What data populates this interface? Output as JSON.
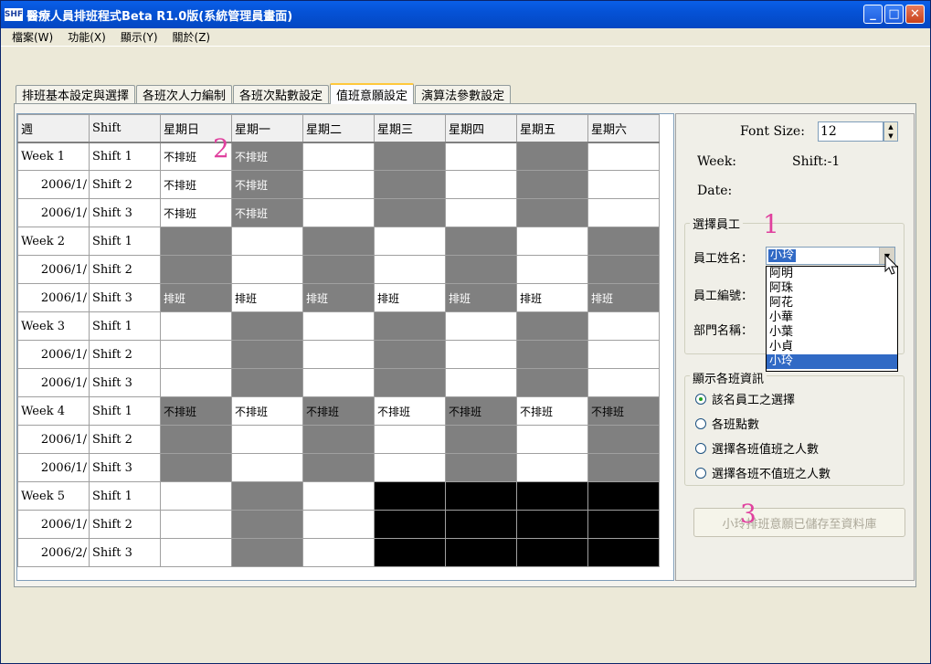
{
  "window": {
    "icon_text": "SHF",
    "title": "醫療人員排班程式Beta R1.0版(系統管理員畫面)",
    "controls": {
      "minimize": "_",
      "maximize": "□",
      "close": "✕"
    }
  },
  "menu": [
    "檔案(W)",
    "功能(X)",
    "顯示(Y)",
    "關於(Z)"
  ],
  "tabs": [
    {
      "label": "排班基本設定與選擇",
      "active": false
    },
    {
      "label": "各班次人力編制",
      "active": false
    },
    {
      "label": "各班次點數設定",
      "active": false
    },
    {
      "label": "值班意願設定",
      "active": true
    },
    {
      "label": "演算法參數設定",
      "active": false
    }
  ],
  "grid": {
    "headers": [
      "週",
      "Shift",
      "星期日",
      "星期一",
      "星期二",
      "星期三",
      "星期四",
      "星期五",
      "星期六"
    ],
    "rows": [
      {
        "week": "Week 1",
        "shift": "Shift 1",
        "sub": false,
        "cells": [
          [
            "不排班",
            "w"
          ],
          [
            "不排班",
            "g"
          ],
          [
            "",
            "w"
          ],
          [
            "",
            "g"
          ],
          [
            "",
            "w"
          ],
          [
            "",
            "g"
          ],
          [
            "",
            "w"
          ]
        ]
      },
      {
        "week": "2006/1/",
        "shift": "Shift 2",
        "sub": true,
        "cells": [
          [
            "不排班",
            "w"
          ],
          [
            "不排班",
            "g"
          ],
          [
            "",
            "w"
          ],
          [
            "",
            "g"
          ],
          [
            "",
            "w"
          ],
          [
            "",
            "g"
          ],
          [
            "",
            "w"
          ]
        ]
      },
      {
        "week": "2006/1/",
        "shift": "Shift 3",
        "sub": true,
        "cells": [
          [
            "不排班",
            "w"
          ],
          [
            "不排班",
            "g"
          ],
          [
            "",
            "w"
          ],
          [
            "",
            "g"
          ],
          [
            "",
            "w"
          ],
          [
            "",
            "g"
          ],
          [
            "",
            "w"
          ]
        ]
      },
      {
        "week": "Week 2",
        "shift": "Shift 1",
        "sub": false,
        "cells": [
          [
            "",
            "g"
          ],
          [
            "",
            "w"
          ],
          [
            "",
            "g"
          ],
          [
            "",
            "w"
          ],
          [
            "",
            "g"
          ],
          [
            "",
            "w"
          ],
          [
            "",
            "g"
          ]
        ]
      },
      {
        "week": "2006/1/",
        "shift": "Shift 2",
        "sub": true,
        "cells": [
          [
            "",
            "g"
          ],
          [
            "",
            "w"
          ],
          [
            "",
            "g"
          ],
          [
            "",
            "w"
          ],
          [
            "",
            "g"
          ],
          [
            "",
            "w"
          ],
          [
            "",
            "g"
          ]
        ]
      },
      {
        "week": "2006/1/",
        "shift": "Shift 3",
        "sub": true,
        "cells": [
          [
            "排班",
            "g"
          ],
          [
            "排班",
            "w"
          ],
          [
            "排班",
            "g"
          ],
          [
            "排班",
            "w"
          ],
          [
            "排班",
            "g"
          ],
          [
            "排班",
            "w"
          ],
          [
            "排班",
            "g"
          ]
        ]
      },
      {
        "week": "Week 3",
        "shift": "Shift 1",
        "sub": false,
        "cells": [
          [
            "",
            "w"
          ],
          [
            "",
            "g"
          ],
          [
            "",
            "w"
          ],
          [
            "",
            "g"
          ],
          [
            "",
            "w"
          ],
          [
            "",
            "g"
          ],
          [
            "",
            "w"
          ]
        ]
      },
      {
        "week": "2006/1/",
        "shift": "Shift 2",
        "sub": true,
        "cells": [
          [
            "",
            "w"
          ],
          [
            "",
            "g"
          ],
          [
            "",
            "w"
          ],
          [
            "",
            "g"
          ],
          [
            "",
            "w"
          ],
          [
            "",
            "g"
          ],
          [
            "",
            "w"
          ]
        ]
      },
      {
        "week": "2006/1/",
        "shift": "Shift 3",
        "sub": true,
        "cells": [
          [
            "",
            "w"
          ],
          [
            "",
            "g"
          ],
          [
            "",
            "w"
          ],
          [
            "",
            "g"
          ],
          [
            "",
            "w"
          ],
          [
            "",
            "g"
          ],
          [
            "",
            "w"
          ]
        ]
      },
      {
        "week": "Week 4",
        "shift": "Shift 1",
        "sub": false,
        "cells": [
          [
            "不排班",
            "gd"
          ],
          [
            "不排班",
            "w"
          ],
          [
            "不排班",
            "gd"
          ],
          [
            "不排班",
            "w"
          ],
          [
            "不排班",
            "gd"
          ],
          [
            "不排班",
            "w"
          ],
          [
            "不排班",
            "gd"
          ]
        ]
      },
      {
        "week": "2006/1/",
        "shift": "Shift 2",
        "sub": true,
        "cells": [
          [
            "",
            "g"
          ],
          [
            "",
            "w"
          ],
          [
            "",
            "g"
          ],
          [
            "",
            "w"
          ],
          [
            "",
            "g"
          ],
          [
            "",
            "w"
          ],
          [
            "",
            "g"
          ]
        ]
      },
      {
        "week": "2006/1/",
        "shift": "Shift 3",
        "sub": true,
        "cells": [
          [
            "",
            "g"
          ],
          [
            "",
            "w"
          ],
          [
            "",
            "g"
          ],
          [
            "",
            "w"
          ],
          [
            "",
            "g"
          ],
          [
            "",
            "w"
          ],
          [
            "",
            "g"
          ]
        ]
      },
      {
        "week": "Week 5",
        "shift": "Shift 1",
        "sub": false,
        "cells": [
          [
            "",
            "w"
          ],
          [
            "",
            "g"
          ],
          [
            "",
            "w"
          ],
          [
            "",
            "b"
          ],
          [
            "",
            "b"
          ],
          [
            "",
            "b"
          ],
          [
            "",
            "b"
          ]
        ]
      },
      {
        "week": "2006/1/",
        "shift": "Shift 2",
        "sub": true,
        "cells": [
          [
            "",
            "w"
          ],
          [
            "",
            "g"
          ],
          [
            "",
            "w"
          ],
          [
            "",
            "b"
          ],
          [
            "",
            "b"
          ],
          [
            "",
            "b"
          ],
          [
            "",
            "b"
          ]
        ]
      },
      {
        "week": "2006/2/",
        "shift": "Shift 3",
        "sub": true,
        "cells": [
          [
            "",
            "w"
          ],
          [
            "",
            "g"
          ],
          [
            "",
            "w"
          ],
          [
            "",
            "b"
          ],
          [
            "",
            "b"
          ],
          [
            "",
            "b"
          ],
          [
            "",
            "b"
          ]
        ]
      }
    ]
  },
  "markers": {
    "m1": "1",
    "m2": "2",
    "m3": "3"
  },
  "right": {
    "font_size_label": "Font Size:",
    "font_size_value": "12",
    "week_label": "Week:",
    "shift_label": "Shift:-1",
    "date_label": "Date:",
    "employee_group": "選擇員工",
    "name_label": "員工姓名：",
    "name_value": "小玲",
    "id_label": "員工編號：",
    "dept_label": "部門名稱：",
    "dropdown": [
      "阿明",
      "阿珠",
      "阿花",
      "小華",
      "小葉",
      "小貞",
      "小玲"
    ],
    "dropdown_selected_index": 6,
    "display_group": "顯示各班資訊",
    "radios": [
      {
        "label": "該名員工之選擇",
        "checked": true
      },
      {
        "label": "各班點數",
        "checked": false
      },
      {
        "label": "選擇各班值班之人數",
        "checked": false
      },
      {
        "label": "選擇各班不值班之人數",
        "checked": false
      }
    ],
    "save_button": "小玲排班意願已儲存至資料庫"
  }
}
